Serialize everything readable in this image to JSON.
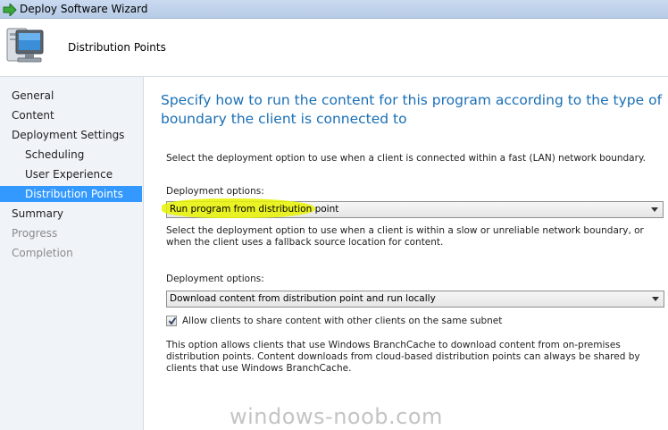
{
  "window": {
    "title": "Deploy Software Wizard"
  },
  "header": {
    "title": "Distribution Points",
    "icon": "computer-monitor-icon"
  },
  "nav": {
    "items": [
      {
        "label": "General",
        "state": "normal"
      },
      {
        "label": "Content",
        "state": "normal"
      },
      {
        "label": "Deployment Settings",
        "state": "normal"
      },
      {
        "label": "Scheduling",
        "state": "normal"
      },
      {
        "label": "User Experience",
        "state": "normal"
      },
      {
        "label": "Distribution Points",
        "state": "selected"
      },
      {
        "label": "Summary",
        "state": "normal"
      },
      {
        "label": "Progress",
        "state": "disabled"
      },
      {
        "label": "Completion",
        "state": "disabled"
      }
    ]
  },
  "main": {
    "heading": "Specify how to run the content for this program according to the type of boundary the client is connected to",
    "fast_description": "Select the deployment option to use when a client is connected within a fast (LAN) network boundary.",
    "fast_label": "Deployment options:",
    "fast_value": "Run program from distribution point",
    "slow_description": "Select the deployment option to use when a client is within a slow or unreliable network boundary, or when the client uses a fallback source location for content.",
    "slow_label": "Deployment options:",
    "slow_value": "Download content from distribution point and run locally",
    "share_checkbox_label": "Allow clients to share content with other clients on the same subnet",
    "share_checkbox_checked": true,
    "branchcache_note": "This option allows clients that use Windows BranchCache to download content from on-premises distribution points. Content downloads from cloud-based distribution points can always be shared by clients that use Windows BranchCache."
  },
  "watermark": "windows-noob.com",
  "colors": {
    "accent": "#1a6fb5",
    "selected": "#3399ff",
    "highlight": "#e8f200"
  }
}
